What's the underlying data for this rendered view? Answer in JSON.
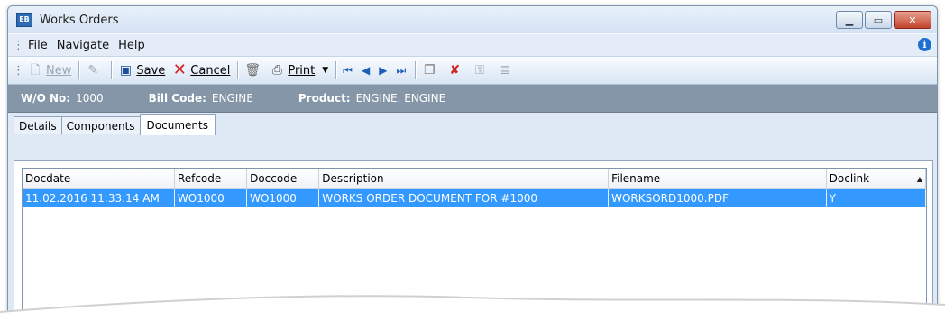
{
  "window": {
    "title": "Works Orders",
    "icon": "app-icon",
    "app_badge": "EB"
  },
  "menu": {
    "items": [
      "File",
      "Navigate",
      "Help"
    ]
  },
  "toolbar": {
    "new_label": "New",
    "save_label": "Save",
    "cancel_label": "Cancel",
    "print_label": "Print"
  },
  "info": {
    "wo_label": "W/O No:",
    "wo_value": "1000",
    "bill_label": "Bill Code:",
    "bill_value": "ENGINE",
    "product_label": "Product:",
    "product_value": "ENGINE. ENGINE"
  },
  "tabs": [
    "Details",
    "Components",
    "Documents"
  ],
  "active_tab": "Documents",
  "grid": {
    "columns": [
      "Docdate",
      "Refcode",
      "Doccode",
      "Description",
      "Filename",
      "Doclink"
    ],
    "rows": [
      [
        "11.02.2016 11:33:14 AM",
        "WO1000",
        "WO1000",
        "WORKS ORDER DOCUMENT FOR #1000",
        "WORKSORD1000.PDF",
        "Y"
      ]
    ],
    "selected_row": 0,
    "sorted_column": "Doclink"
  },
  "colors": {
    "selection": "#3399ff",
    "infobar": "#8496a8",
    "close": "#c2422a"
  }
}
